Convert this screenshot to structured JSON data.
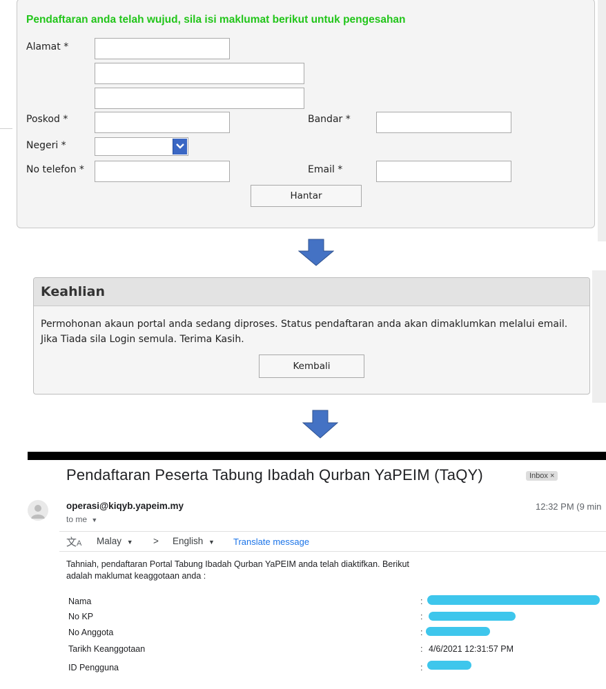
{
  "form": {
    "heading": "Pendaftaran anda telah wujud, sila isi maklumat berikut untuk pengesahan",
    "alamat_label": "Alamat *",
    "poskod_label": "Poskod *",
    "bandar_label": "Bandar *",
    "negeri_label": "Negeri *",
    "telefon_label": "No telefon *",
    "email_label": "Email *",
    "submit_label": "Hantar"
  },
  "keahlian": {
    "title": "Keahlian",
    "message": "Permohonan akaun portal anda sedang diproses. Status pendaftaran anda akan dimaklumkan melalui email. Jika Tiada sila Login semula. Terima Kasih.",
    "back_label": "Kembali"
  },
  "email": {
    "subject": "Pendaftaran Peserta Tabung Ibadah Qurban YaPEIM (TaQY)",
    "badge": "Inbox ×",
    "sender": "operasi@kiqyb.yapeim.my",
    "to": "to me",
    "time": "12:32 PM (9 min",
    "translate": {
      "from": "Malay",
      "sep": ">",
      "to": "English",
      "link": "Translate message"
    },
    "body": "Tahniah, pendaftaran Portal Tabung Ibadah Qurban YaPEIM anda telah diaktifkan. Berikut adalah maklumat keaggotaan anda :",
    "rows": [
      {
        "label": "Nama",
        "colon": ":",
        "value": ""
      },
      {
        "label": "No KP",
        "colon": ":",
        "value": ""
      },
      {
        "label": "No Anggota",
        "colon": ":",
        "value": ""
      },
      {
        "label": "Tarikh Keanggotaan",
        "colon": ":",
        "value": "4/6/2021 12:31:57 PM"
      },
      {
        "label": "ID Pengguna",
        "colon": ":",
        "value": ""
      }
    ]
  },
  "colors": {
    "heading_green": "#22c51a",
    "arrow_blue": "#4472c4",
    "redaction": "#3ec6ec"
  }
}
